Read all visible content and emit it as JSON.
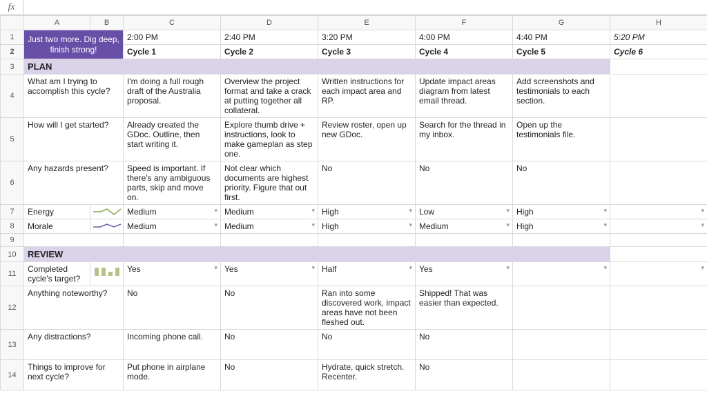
{
  "fx": {
    "label": "fx",
    "value": ""
  },
  "colHeaders": [
    "A",
    "B",
    "C",
    "D",
    "E",
    "F",
    "G",
    "H"
  ],
  "rowHeaders": [
    "1",
    "2",
    "3",
    "4",
    "5",
    "6",
    "7",
    "8",
    "9",
    "10",
    "11",
    "12",
    "13",
    "14"
  ],
  "motivate": "Just two more. Dig deep, finish strong!",
  "times": [
    "2:00 PM",
    "2:40 PM",
    "3:20 PM",
    "4:00 PM",
    "4:40 PM",
    "5:20 PM"
  ],
  "cycles": [
    "Cycle 1",
    "Cycle 2",
    "Cycle 3",
    "Cycle 4",
    "Cycle 5",
    "Cycle 6"
  ],
  "sections": {
    "plan": "PLAN",
    "review": "REVIEW"
  },
  "plan": {
    "q1": {
      "label": "What am I trying to accomplish this cycle?",
      "c": [
        "I'm doing a full rough draft of the Australia proposal.",
        "Overview the project format and take a crack at putting together all collateral.",
        "Written instructions for each impact area and RP.",
        "Update impact areas diagram from latest email thread.",
        "Add screenshots and testimonials to each section.",
        ""
      ]
    },
    "q2": {
      "label": "How will I get started?",
      "c": [
        "Already created the GDoc. Outline, then start writing it.",
        "Explore thumb drive + instructions, look to make gameplan as step one.",
        "Review roster, open up new GDoc.",
        "Search for the thread in my inbox.",
        "Open up the testimonials file.",
        ""
      ]
    },
    "q3": {
      "label": "Any hazards present?",
      "c": [
        "Speed is important. If there's any ambiguous parts, skip and move on.",
        "Not clear which documents are highest priority. Figure that out first.",
        "No",
        "No",
        "No",
        ""
      ]
    },
    "energy": {
      "label": "Energy",
      "c": [
        "Medium",
        "Medium",
        "High",
        "Low",
        "High",
        ""
      ]
    },
    "morale": {
      "label": "Morale",
      "c": [
        "Medium",
        "Medium",
        "High",
        "Medium",
        "High",
        ""
      ]
    }
  },
  "review": {
    "q1": {
      "label": "Completed cycle's target?",
      "c": [
        "Yes",
        "Yes",
        "Half",
        "Yes",
        "",
        ""
      ]
    },
    "q2": {
      "label": "Anything noteworthy?",
      "c": [
        "No",
        "No",
        "Ran into some discovered work, impact areas have not been fleshed out.",
        "Shipped! That was easier than expected.",
        "",
        ""
      ]
    },
    "q3": {
      "label": "Any distractions?",
      "c": [
        "Incoming phone call.",
        "No",
        "No",
        "No",
        "",
        ""
      ]
    },
    "q4": {
      "label": "Things to improve for next cycle?",
      "c": [
        "Put phone in airplane mode.",
        "No",
        "Hydrate, quick stretch. Recenter.",
        "No",
        "",
        ""
      ]
    }
  },
  "chart_data": [
    {
      "type": "line",
      "title": "Energy sparkline",
      "categories": [
        "Cycle 1",
        "Cycle 2",
        "Cycle 3",
        "Cycle 4",
        "Cycle 5"
      ],
      "values": [
        2,
        2,
        3,
        1,
        3
      ],
      "scale": {
        "Low": 1,
        "Medium": 2,
        "High": 3
      }
    },
    {
      "type": "line",
      "title": "Morale sparkline",
      "categories": [
        "Cycle 1",
        "Cycle 2",
        "Cycle 3",
        "Cycle 4",
        "Cycle 5"
      ],
      "values": [
        2,
        2,
        3,
        2,
        3
      ],
      "scale": {
        "Low": 1,
        "Medium": 2,
        "High": 3
      }
    },
    {
      "type": "bar",
      "title": "Completed cycle's target sparkline",
      "categories": [
        "Cycle 1",
        "Cycle 2",
        "Cycle 3",
        "Cycle 4"
      ],
      "values": [
        1,
        1,
        0.5,
        1
      ],
      "scale": {
        "No": 0,
        "Half": 0.5,
        "Yes": 1
      }
    }
  ]
}
